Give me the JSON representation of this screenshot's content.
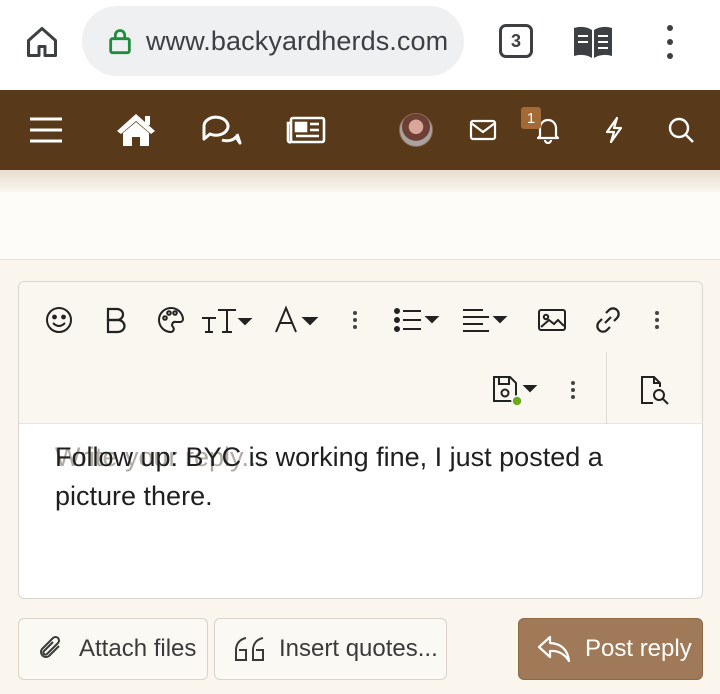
{
  "browser": {
    "url": "www.backyardherds.com",
    "tab_count": "3"
  },
  "site_nav": {
    "notification_count": "1"
  },
  "editor": {
    "placeholder": "Write your reply...",
    "content": "Follow up: BYC is working fine, I just posted a picture there."
  },
  "actions": {
    "attach_label": "Attach files",
    "insert_quotes_label": "Insert quotes...",
    "post_reply_label": "Post reply"
  },
  "colors": {
    "nav_bg": "#58391a",
    "primary_button": "#a07a58",
    "lock_green": "#1e8e3e"
  }
}
